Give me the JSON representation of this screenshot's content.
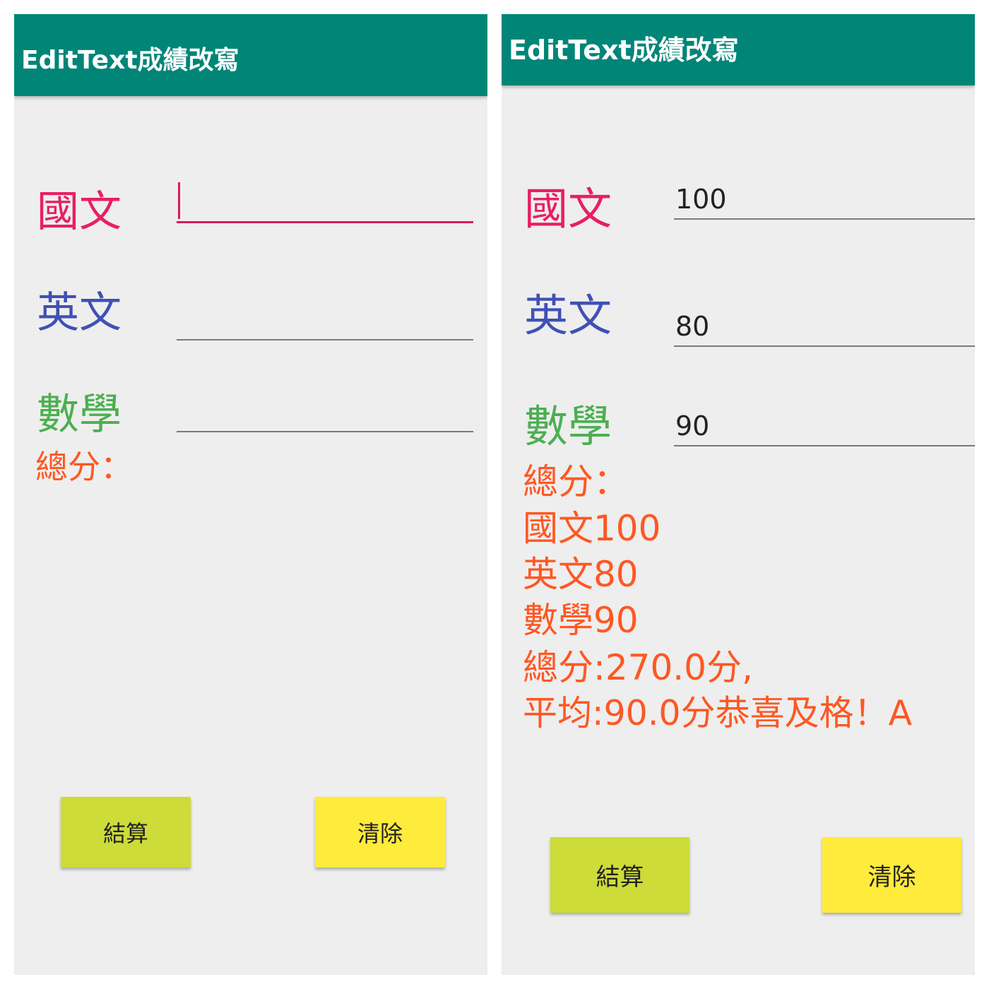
{
  "colors": {
    "appbar": "#008577",
    "chinese": "#e91e63",
    "english": "#3f51b5",
    "math": "#4caf50",
    "result": "#ff5722",
    "calc_button": "#cddc39",
    "clear_button": "#ffeb3b"
  },
  "left_screen": {
    "title": "EditText成績改寫",
    "labels": {
      "chinese": "國文",
      "english": "英文",
      "math": "數學"
    },
    "result_lines": [
      "總分："
    ],
    "buttons": {
      "calc": "結算",
      "clear": "清除"
    }
  },
  "right_screen": {
    "title": "EditText成績改寫",
    "labels": {
      "chinese": "國文",
      "english": "英文",
      "math": "數學"
    },
    "inputs": {
      "chinese": "100",
      "english": "80",
      "math": "90"
    },
    "result_lines": [
      "總分：",
      "國文100",
      "英文80",
      "數學90",
      "總分:270.0分,",
      "平均:90.0分恭喜及格！A"
    ],
    "buttons": {
      "calc": "結算",
      "clear": "清除"
    }
  }
}
